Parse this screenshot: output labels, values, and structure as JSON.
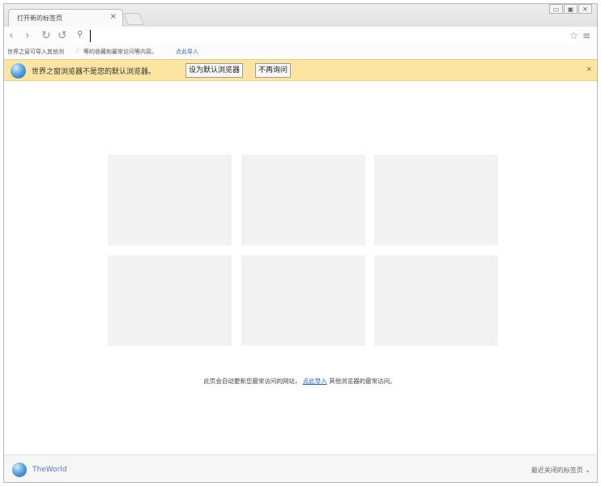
{
  "tab": {
    "title": "打开新的标签页",
    "close": "×"
  },
  "window_controls": {
    "restore": "▭",
    "maximize": "▣",
    "close": "✕"
  },
  "nav": {
    "back": "‹",
    "forward": "›",
    "reload": "↻",
    "undo": "↺",
    "search_glyph": "⚲",
    "address_value": "",
    "star": "☆",
    "menu": "≡"
  },
  "import_bar": {
    "text_a": "世界之窗可导入其他浏",
    "text_b": "等的收藏和最常访问等内容。",
    "link": "点此导入"
  },
  "infobar": {
    "message": "世界之窗浏览器不是您的默认浏览器。",
    "set_default_label": "设为默认浏览器",
    "dont_ask_label": "不再询问",
    "close": "×"
  },
  "tiles": [
    {
      "label": ""
    },
    {
      "label": ""
    },
    {
      "label": ""
    },
    {
      "label": ""
    },
    {
      "label": ""
    },
    {
      "label": ""
    }
  ],
  "footnote": {
    "before": "此页会自动更新您最常访问的网站，",
    "link": "点此导入",
    "after": "其他浏览器的最常访问。"
  },
  "status": {
    "brand": "TheWorld",
    "recent_label": "最近关闭的标签页",
    "recent_chevron": "⌄"
  },
  "colors": {
    "infobar_bg": "#fbe5a0",
    "tile_bg": "#f2f2f2",
    "link": "#2060cc"
  }
}
